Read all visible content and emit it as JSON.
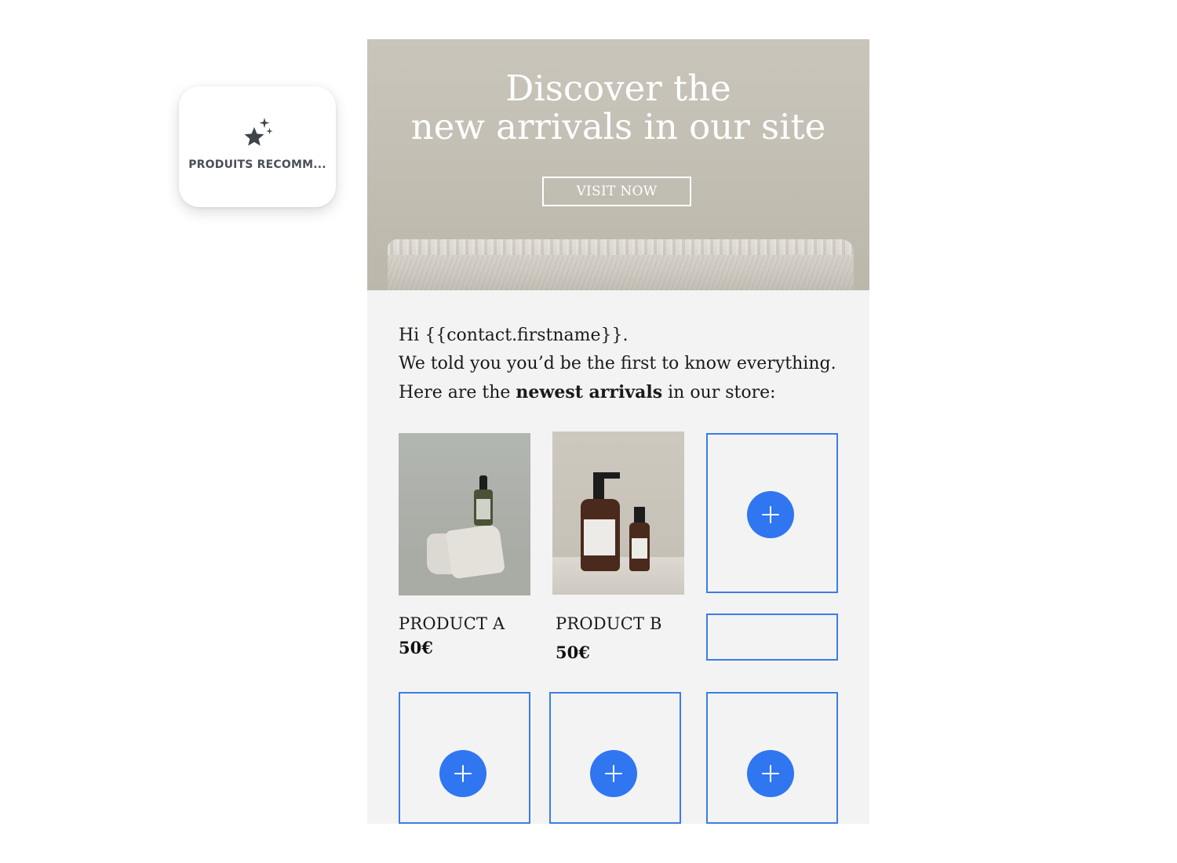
{
  "block_card": {
    "icon": "sparkle-star-icon",
    "label": "PRODUITS RECOMM..."
  },
  "hero": {
    "title_line1": "Discover the",
    "title_line2": "new arrivals in our site",
    "button_label": "VISIT NOW"
  },
  "intro": {
    "line1": "Hi {{contact.firstname}}.",
    "line2": "We told you you’d be the first to know everything.",
    "line3_before": "Here are the ",
    "line3_bold": "newest arrivals",
    "line3_after": " in our store:"
  },
  "products": [
    {
      "name": "PRODUCT A",
      "price": "50€"
    },
    {
      "name": "PRODUCT B",
      "price": "50€"
    }
  ],
  "colors": {
    "accent": "#2f76f0",
    "slot_border": "#3b7de6",
    "canvas_bg": "#f3f3f3"
  }
}
